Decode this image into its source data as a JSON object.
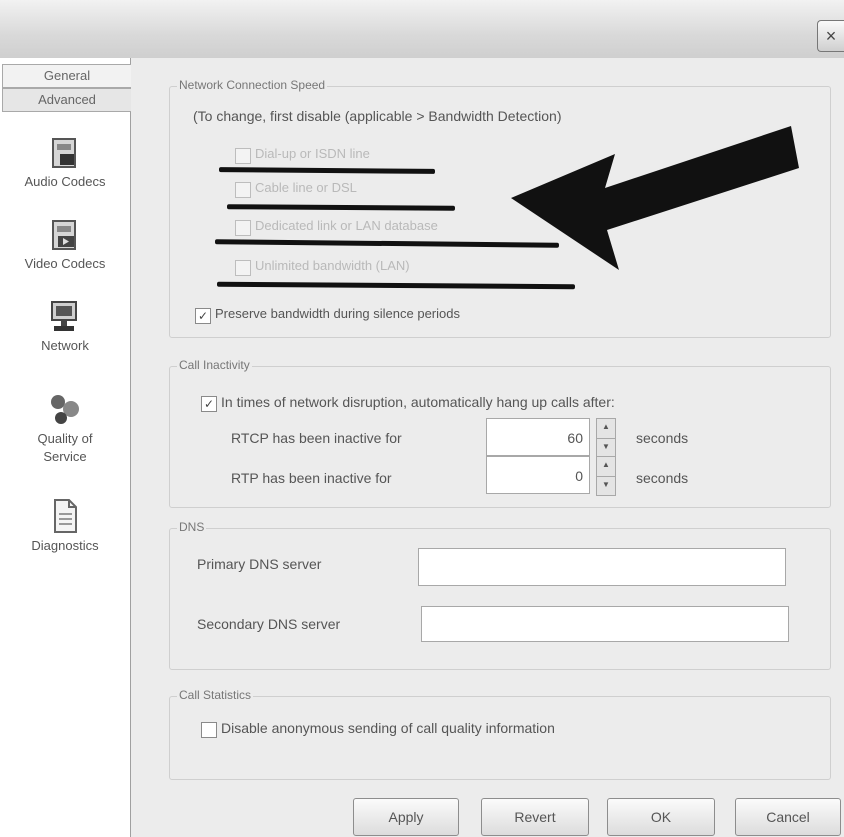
{
  "window": {
    "close_glyph": "×"
  },
  "sidebar": {
    "tabs": [
      "General",
      "Advanced"
    ],
    "items": [
      {
        "label": "Audio Codecs",
        "icon": "audio-codecs-icon"
      },
      {
        "label": "Video Codecs",
        "icon": "video-codecs-icon"
      },
      {
        "label": "Network",
        "icon": "network-icon"
      },
      {
        "label": "Quality of Service",
        "icon": "quality-of-service-icon"
      },
      {
        "label": "Diagnostics",
        "icon": "diagnostics-icon"
      }
    ]
  },
  "network_speed": {
    "group_label": "Network Connection Speed",
    "note": "(To change, first disable (applicable > Bandwidth Detection)",
    "options": [
      {
        "label": "Dial-up or ISDN line",
        "checked": false
      },
      {
        "label": "Cable line or DSL",
        "checked": false
      },
      {
        "label": "Dedicated link or LAN database",
        "checked": false
      },
      {
        "label": "Unlimited bandwidth (LAN)",
        "checked": false
      }
    ],
    "preserve_bandwidth": {
      "label": "Preserve bandwidth during silence periods",
      "checked": true
    }
  },
  "call_inactivity": {
    "group_label": "Call Inactivity",
    "auto_hangup": {
      "label": "In times of network disruption, automatically hang up calls after:",
      "checked": true
    },
    "rtcp": {
      "label": "RTCP has been inactive for",
      "value": "60",
      "unit": "seconds"
    },
    "rtp": {
      "label": "RTP has been inactive for",
      "value": "0",
      "unit": "seconds"
    }
  },
  "dns": {
    "group_label": "DNS",
    "primary": {
      "label": "Primary DNS server",
      "value": ""
    },
    "secondary": {
      "label": "Secondary DNS server",
      "value": ""
    }
  },
  "call_statistics": {
    "group_label": "Call Statistics",
    "anonymous": {
      "label": "Disable anonymous sending of call quality information",
      "checked": false
    }
  },
  "buttons": {
    "apply": "Apply",
    "revert": "Revert",
    "ok": "OK",
    "cancel": "Cancel"
  },
  "colors": {
    "annotation": "#111111",
    "window_bg": "#ececec"
  }
}
